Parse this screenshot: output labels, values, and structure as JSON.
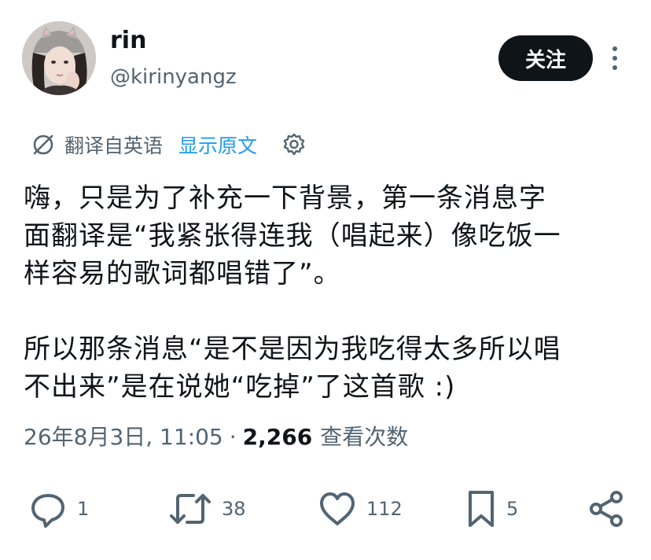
{
  "author": {
    "display_name": "rin",
    "handle": "@kirinyangz",
    "follow_label": "关注"
  },
  "translation": {
    "label": "翻译自英语",
    "show_original": "显示原文"
  },
  "body": {
    "lines": [
      "嗨，只是为了补充一下背景，第一条消息字",
      "面翻译是“我紧张得连我（唱起来）像吃饭一",
      "样容易的歌词都唱错了”。",
      "所以那条消息“是不是因为我吃得太多所以唱",
      "不出来”是在说她“吃掉”了这首歌 :)"
    ]
  },
  "meta": {
    "timestamp": "26年8月3日, 11:05",
    "separator": "·",
    "views_count": "2,266",
    "views_label": "查看次数"
  },
  "actions": {
    "reply_count": "1",
    "retweet_count": "38",
    "like_count": "112",
    "bookmark_count": "5"
  },
  "colors": {
    "text": "#0f1419",
    "secondary": "#536471",
    "link": "#1d9bf0",
    "follow_bg": "#0f1419"
  },
  "icons": [
    "translate-icon",
    "gear-icon",
    "more-icon",
    "reply-icon",
    "retweet-icon",
    "like-icon",
    "bookmark-icon",
    "share-icon"
  ]
}
